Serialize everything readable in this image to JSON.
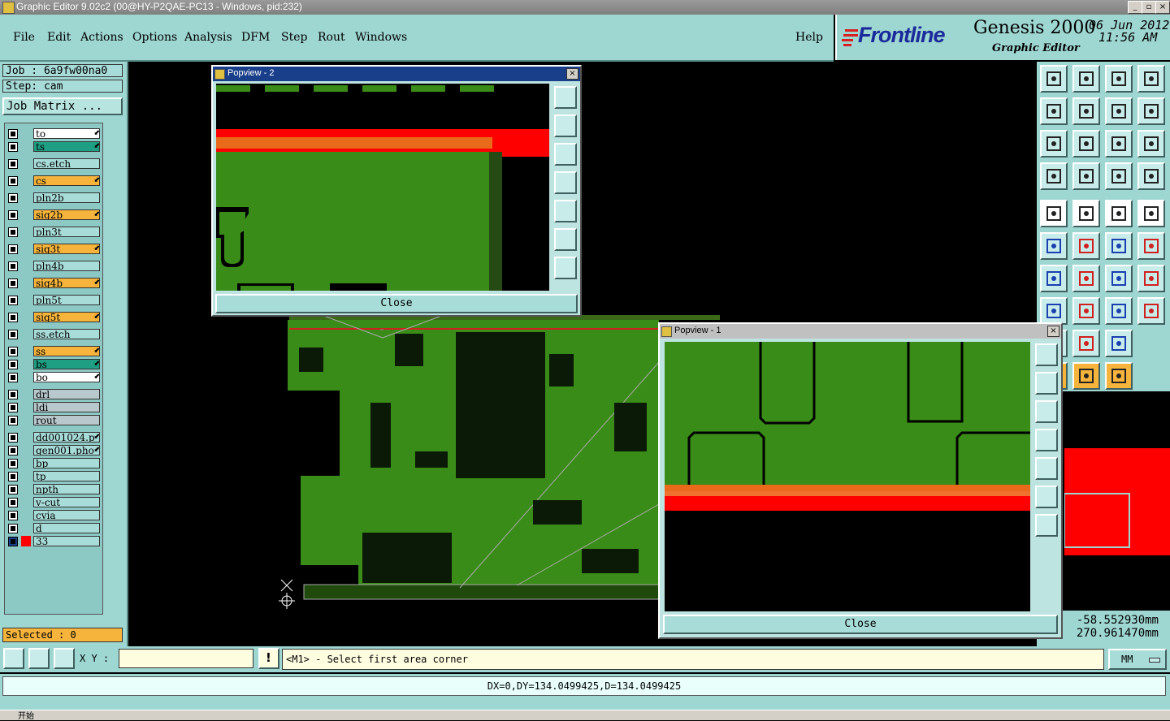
{
  "window": {
    "title": "Graphic Editor 9.02c2 (00@HY-P2QAE-PC13 - Windows, pid:232)",
    "minimize": "_",
    "maximize": "▫",
    "close": "×"
  },
  "menu": {
    "items": [
      "File",
      "Edit",
      "Actions",
      "Options",
      "Analysis",
      "DFM",
      "Step",
      "Rout",
      "Windows"
    ],
    "help": "Help"
  },
  "brand": {
    "logo": "Frontline",
    "product": "Genesis 2000",
    "subtitle": "Graphic Editor",
    "date": "06 Jun 2012",
    "time": "11:56 AM"
  },
  "job": {
    "job_line": "Job : 6a9fw00na0",
    "step_line": "Step: cam",
    "matrix_button": "Job Matrix ..."
  },
  "layers": [
    {
      "name": "to",
      "color": "#ffffff",
      "arrow": true
    },
    {
      "name": "ts",
      "color": "#1e9e82",
      "arrow": true
    },
    {
      "name": "cs.etch",
      "color": "#a8dcd8",
      "arrow": false
    },
    {
      "name": "cs",
      "color": "#f6b43c",
      "arrow": true
    },
    {
      "name": "pln2b",
      "color": "#a8dcd8",
      "arrow": false
    },
    {
      "name": "sig2b",
      "color": "#f6b43c",
      "arrow": true
    },
    {
      "name": "pln3t",
      "color": "#a8dcd8",
      "arrow": false
    },
    {
      "name": "sig3t",
      "color": "#f6b43c",
      "arrow": true
    },
    {
      "name": "pln4b",
      "color": "#a8dcd8",
      "arrow": false
    },
    {
      "name": "sig4b",
      "color": "#f6b43c",
      "arrow": true
    },
    {
      "name": "pln5t",
      "color": "#a8dcd8",
      "arrow": false
    },
    {
      "name": "sig5t",
      "color": "#f6b43c",
      "arrow": true
    },
    {
      "name": "ss.etch",
      "color": "#a8dcd8",
      "arrow": false
    },
    {
      "name": "ss",
      "color": "#f6b43c",
      "arrow": true
    },
    {
      "name": "bs",
      "color": "#1e9e82",
      "arrow": true
    },
    {
      "name": "bo",
      "color": "#ffffff",
      "arrow": true
    },
    {
      "name": "drl",
      "color": "#b8c8cc",
      "arrow": false
    },
    {
      "name": "ldi",
      "color": "#b8c8cc",
      "arrow": false
    },
    {
      "name": "rout",
      "color": "#b8c8cc",
      "arrow": false
    },
    {
      "name": "dd001024.p",
      "color": "#a8dcd8",
      "arrow": true
    },
    {
      "name": "gen001.pho",
      "color": "#a8dcd8",
      "arrow": true
    },
    {
      "name": "bp",
      "color": "#a8dcd8",
      "arrow": false
    },
    {
      "name": "tp",
      "color": "#a8dcd8",
      "arrow": false
    },
    {
      "name": "npth",
      "color": "#a8dcd8",
      "arrow": false
    },
    {
      "name": "v-cut",
      "color": "#a8dcd8",
      "arrow": false
    },
    {
      "name": "cvia",
      "color": "#a8dcd8",
      "arrow": false
    },
    {
      "name": "d",
      "color": "#a8dcd8",
      "arrow": false
    },
    {
      "name": "33",
      "color": "#a8dcd8",
      "arrow": false
    }
  ],
  "selected": "Selected : 0",
  "popview2": {
    "title": "Popview - 2",
    "close": "Close"
  },
  "popview1": {
    "title": "Popview - 1",
    "close": "Close"
  },
  "coords": {
    "x": "-58.552930mm",
    "y": "270.961470mm"
  },
  "command": {
    "xy_label": "X Y :",
    "xy_value": "",
    "prompt": "<M1> - Select first area corner",
    "units": "MM"
  },
  "status": "DX=0,DY=134.0499425,D=134.0499425",
  "taskbar_start": "开始"
}
